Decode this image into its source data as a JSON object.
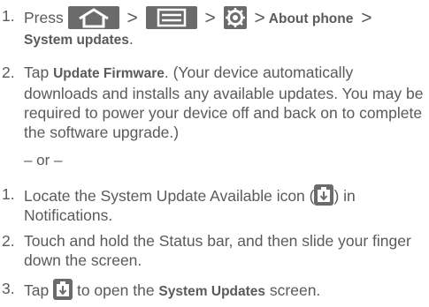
{
  "steps_a": [
    {
      "number": "1.",
      "text_press": "Press",
      "sep": ">",
      "about_phone": "About phone",
      "system_updates": "System updates",
      "period": "."
    },
    {
      "number": "2.",
      "text_tap": "Tap",
      "update_firmware": "Update Firmware",
      "rest": ". (Your device automatically downloads and installs any available updates. You may be required to power your device off and back on to complete the software upgrade.)"
    }
  ],
  "or_text": "– or –",
  "steps_b": [
    {
      "number": "1.",
      "text_before": "Locate the System Update Available icon (",
      "text_after": ") in Notifications."
    },
    {
      "number": "2.",
      "text": "Touch and hold the Status bar, and then slide your finger down the screen."
    },
    {
      "number": "3.",
      "text_tap": "Tap",
      "text_middle": "to open the",
      "system_updates": "System Updates",
      "text_end": "screen."
    }
  ],
  "icons": {
    "home": "home-icon",
    "menu": "menu-icon",
    "settings": "settings-icon",
    "system_update": "system-update-icon"
  },
  "colors": {
    "text": "#5a5a5a",
    "icon_bg": "#6b6b6b"
  }
}
